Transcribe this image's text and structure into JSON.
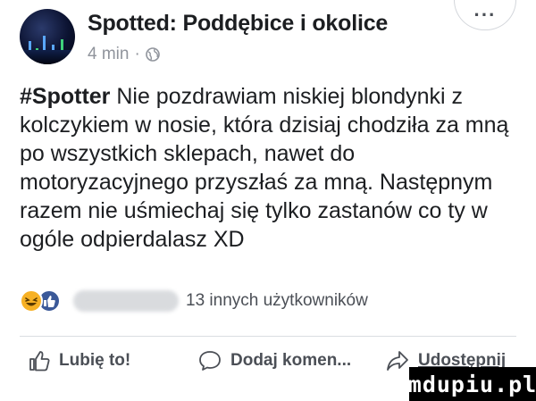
{
  "post": {
    "page_name": "Spotted: Poddębice i okolice",
    "time": "4 min",
    "separator": "·",
    "more_label": "···",
    "hashtag": "#Spotter",
    "text": " Nie pozdrawiam niskiej blondynki z kolczykiem w nosie, która dzisiaj chodziła za mną po wszystkich sklepach, nawet do motoryzacyjnego przyszłaś za mną. Następnym razem nie uśmiechaj się tylko zastanów co ty w ogóle odpierdalasz XD"
  },
  "reactions": {
    "others_text": "13 innych użytkowników"
  },
  "actions": {
    "like_label": "Lubię to!",
    "comment_label": "Dodaj komen...",
    "share_label": "Udostępnij"
  },
  "watermark": "mdupiu.pl",
  "colors": {
    "text": "#1c1e21",
    "meta": "#90949c",
    "action": "#4b4f56",
    "like_blue": "#3b5998",
    "haha_yellow": "#f7b125"
  },
  "icons": {
    "globe": "globe-icon",
    "more": "more-icon",
    "like": "thumbs-up-icon",
    "comment": "comment-icon",
    "share": "share-icon"
  }
}
